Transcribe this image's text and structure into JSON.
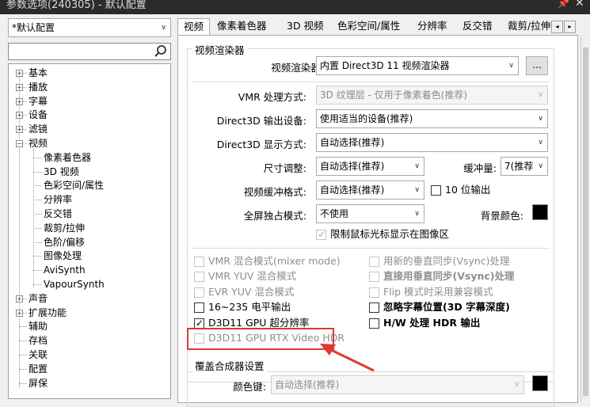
{
  "window": {
    "title": "参数选项(240305) - 默认配置",
    "pin": "📌",
    "close": "✕"
  },
  "profile_select": {
    "value": "*默认配置"
  },
  "search": {
    "placeholder": ""
  },
  "tree": {
    "items": [
      {
        "label": "基本",
        "expander": "+"
      },
      {
        "label": "播放",
        "expander": "+"
      },
      {
        "label": "字幕",
        "expander": "+"
      },
      {
        "label": "设备",
        "expander": "+"
      },
      {
        "label": "滤镜",
        "expander": "+"
      },
      {
        "label": "视频",
        "expander": "−"
      },
      {
        "label": "像素着色器"
      },
      {
        "label": "3D 视频"
      },
      {
        "label": "色彩空间/属性"
      },
      {
        "label": "分辨率"
      },
      {
        "label": "反交错"
      },
      {
        "label": "裁剪/拉伸"
      },
      {
        "label": "色阶/偏移"
      },
      {
        "label": "图像处理"
      },
      {
        "label": "AviSynth"
      },
      {
        "label": "VapourSynth"
      },
      {
        "label": "声音",
        "expander": "+"
      },
      {
        "label": "扩展功能",
        "expander": "+"
      },
      {
        "label": "辅助"
      },
      {
        "label": "存档"
      },
      {
        "label": "关联"
      },
      {
        "label": "配置"
      },
      {
        "label": "屏保"
      }
    ]
  },
  "tabs": [
    "视频",
    "像素着色器",
    "3D 视频",
    "色彩空间/属性",
    "分辨率",
    "反交错",
    "裁剪/拉伸"
  ],
  "tab_nav": {
    "prev": "◂",
    "next": "▸"
  },
  "renderer_group": {
    "title": "视频渲染器",
    "renderer_label": "视频渲染器:",
    "renderer_value": "内置 Direct3D 11 视频渲染器",
    "more_button": "...",
    "vmr_label": "VMR 处理方式:",
    "vmr_value": "3D 纹理层 - 仅用于像素着色(推荐)",
    "d3d_device_label": "Direct3D 输出设备:",
    "d3d_device_value": "使用适当的设备(推荐)",
    "d3d_display_label": "Direct3D 显示方式:",
    "d3d_display_value": "自动选择(推荐)",
    "resize_label": "尺寸调整:",
    "resize_value": "自动选择(推荐)",
    "buffer_label": "缓冲量:",
    "buffer_value": "7(推荐",
    "buffer_format_label": "视频缓冲格式:",
    "buffer_format_value": "自动选择(推荐)",
    "tenbit_label": "10 位输出",
    "fullscreen_label": "全屏独占模式:",
    "fullscreen_value": "不使用",
    "bgcolor_label": "背景颜色:",
    "cursor_limit_label": "限制鼠标光标显示在图像区",
    "options_left": [
      {
        "label": "VMR 混合模式(mixer mode)",
        "disabled": true,
        "checked": false,
        "bold": false
      },
      {
        "label": "VMR YUV 混合模式",
        "disabled": true,
        "checked": false,
        "bold": false
      },
      {
        "label": "EVR YUV 混合模式",
        "disabled": true,
        "checked": false,
        "bold": false
      },
      {
        "label": "16~235 电平输出",
        "disabled": false,
        "checked": false,
        "bold": false
      },
      {
        "label": "D3D11 GPU 超分辨率",
        "disabled": false,
        "checked": true,
        "bold": false
      },
      {
        "label": "D3D11 GPU RTX Video HDR",
        "disabled": true,
        "checked": false,
        "bold": false
      }
    ],
    "options_right": [
      {
        "label": "用新的垂直同步(Vsync)处理",
        "disabled": true,
        "checked": false,
        "bold": false
      },
      {
        "label": "直接用垂直同步(Vsync)处理",
        "disabled": true,
        "checked": false,
        "bold": true
      },
      {
        "label": "Flip 模式时采用兼容模式",
        "disabled": true,
        "checked": false,
        "bold": false
      },
      {
        "label": "忽略字幕位置(3D 字幕深度)",
        "disabled": false,
        "checked": false,
        "bold": true
      },
      {
        "label": "H/W 处理 HDR 输出",
        "disabled": false,
        "checked": false,
        "bold": true
      }
    ]
  },
  "overlay_group": {
    "title": "覆盖合成器设置",
    "color_key_label": "颜色键:",
    "color_key_value": "自动选择(推荐)"
  },
  "colors": {
    "highlight_box": "#e0392f",
    "arrow": "#e0392f",
    "swatch": "#000000"
  },
  "icons": {
    "search": "search-icon",
    "dropdown": "chevron-down-icon"
  }
}
